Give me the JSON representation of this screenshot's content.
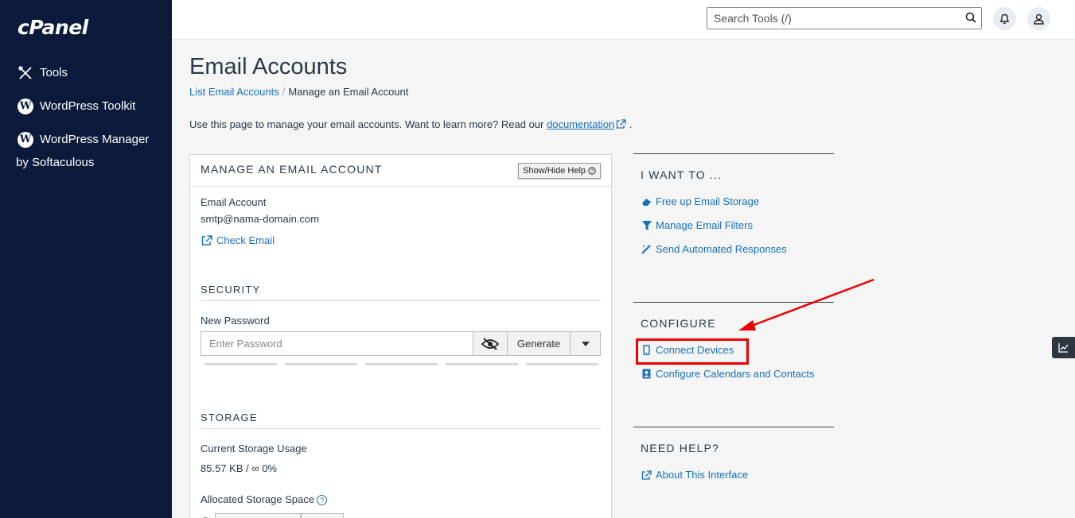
{
  "sidebar": {
    "logo": "cPanel",
    "items": [
      {
        "label": "Tools",
        "icon": "tools-icon"
      },
      {
        "label": "WordPress Toolkit",
        "icon": "wordpress-icon"
      },
      {
        "label": "WordPress Manager by Softaculous",
        "icon": "wordpress-icon"
      }
    ]
  },
  "topbar": {
    "search_placeholder": "Search Tools (/)"
  },
  "main": {
    "title": "Email Accounts",
    "breadcrumb": {
      "link": "List Email Accounts",
      "separator": "/",
      "current": "Manage an Email Account"
    },
    "intro": {
      "text": "Use this page to manage your email accounts. Want to learn more? Read our",
      "link": "documentation",
      "end": "."
    },
    "panel": {
      "title": "MANAGE AN EMAIL ACCOUNT",
      "help_button": "Show/Hide Help",
      "email_label": "Email Account",
      "email_value": "smtp@nama-domain.com",
      "check_email": "Check Email",
      "security_heading": "SECURITY",
      "new_password_label": "New Password",
      "password_placeholder": "Enter Password",
      "generate_label": "Generate",
      "storage_heading": "STORAGE",
      "storage_usage_label": "Current Storage Usage",
      "storage_usage_value": "85.57 KB / ∞ 0%",
      "allocated_label": "Allocated Storage Space"
    }
  },
  "right": {
    "want_to": {
      "heading": "I WANT TO ...",
      "links": [
        "Free up Email Storage",
        "Manage Email Filters",
        "Send Automated Responses"
      ]
    },
    "configure": {
      "heading": "CONFIGURE",
      "links": [
        "Connect Devices",
        "Configure Calendars and Contacts"
      ]
    },
    "need_help": {
      "heading": "NEED HELP?",
      "links": [
        "About This Interface"
      ]
    }
  },
  "colors": {
    "sidebar_bg": "#0b1a3b",
    "link": "#1672b8",
    "highlight": "#e00000"
  }
}
